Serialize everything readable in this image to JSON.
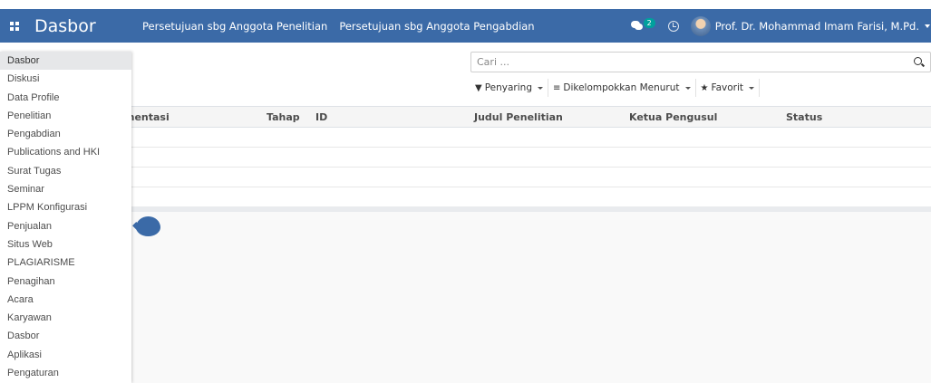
{
  "navbar": {
    "brand": "Dasbor",
    "menu": [
      "Persetujuan sbg Anggota Penelitian",
      "Persetujuan sbg Anggota Pengabdian"
    ],
    "chat_count": "2",
    "user_name": "Prof. Dr. Mohammad Imam Farisi, M.Pd.",
    "accent_color": "#3b6aa7",
    "badge_color": "#00a09d"
  },
  "search": {
    "placeholder": "Cari ...",
    "filters_label": "Penyaring",
    "group_by_label": "Dikelompokkan Menurut",
    "favorites_label": "Favorit"
  },
  "table": {
    "columns": [
      "mentasi",
      "Tahap",
      "ID",
      "Judul Penelitian",
      "Ketua Pengusul",
      "Status"
    ]
  },
  "app_menu": {
    "items": [
      "Dasbor",
      "Diskusi",
      "Data Profile",
      "Penelitian",
      "Pengabdian",
      "Publications and HKI",
      "Surat Tugas",
      "Seminar",
      "LPPM Konfigurasi",
      "Penjualan",
      "Situs Web",
      "PLAGIARISME",
      "Penagihan",
      "Acara",
      "Karyawan",
      "Dasbor",
      "Aplikasi",
      "Pengaturan"
    ]
  }
}
